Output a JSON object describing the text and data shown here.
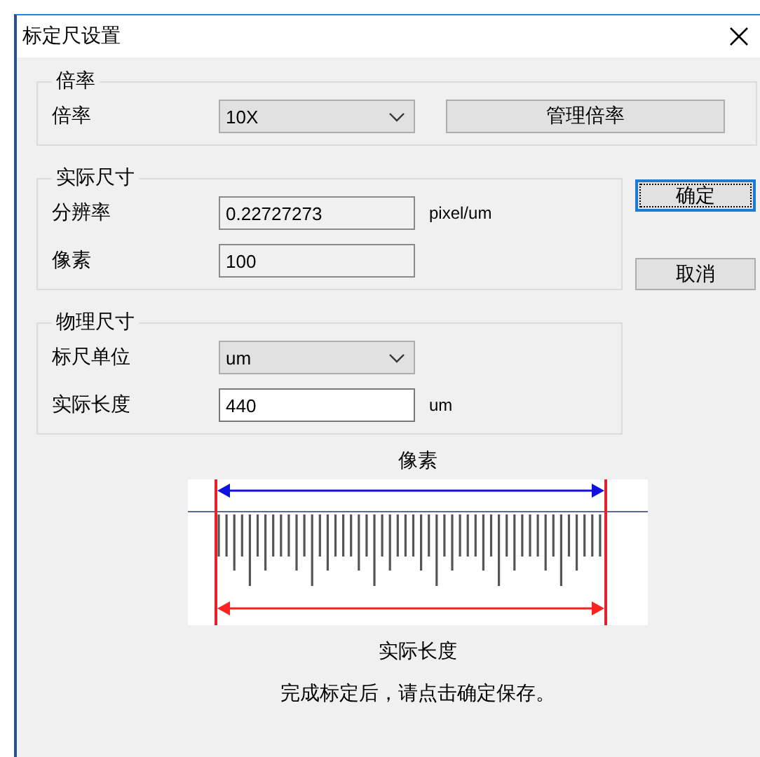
{
  "window": {
    "title": "标定尺设置"
  },
  "magnification": {
    "legend": "倍率",
    "label": "倍率",
    "value": "10X",
    "button": "管理倍率"
  },
  "actual_size": {
    "legend": "实际尺寸",
    "rows": [
      {
        "kind": "field",
        "label": "分辨率",
        "value": "0.22727273",
        "unit": "pixel/um",
        "disabled": true
      },
      {
        "kind": "field",
        "label": "像素",
        "value": "100",
        "disabled": true
      }
    ]
  },
  "physical_size": {
    "legend": "物理尺寸",
    "rows": [
      {
        "kind": "select",
        "label": "标尺单位",
        "value": "um"
      },
      {
        "kind": "field",
        "label": "实际长度",
        "value": "440",
        "unit": "um",
        "disabled": false
      }
    ]
  },
  "buttons": [
    {
      "label": "确定",
      "default": true
    },
    {
      "label": "取消",
      "default": false
    }
  ],
  "diagram": {
    "top_label": "像素",
    "bottom_label": "实际长度"
  },
  "message": "完成标定后，请点击确定保存。"
}
